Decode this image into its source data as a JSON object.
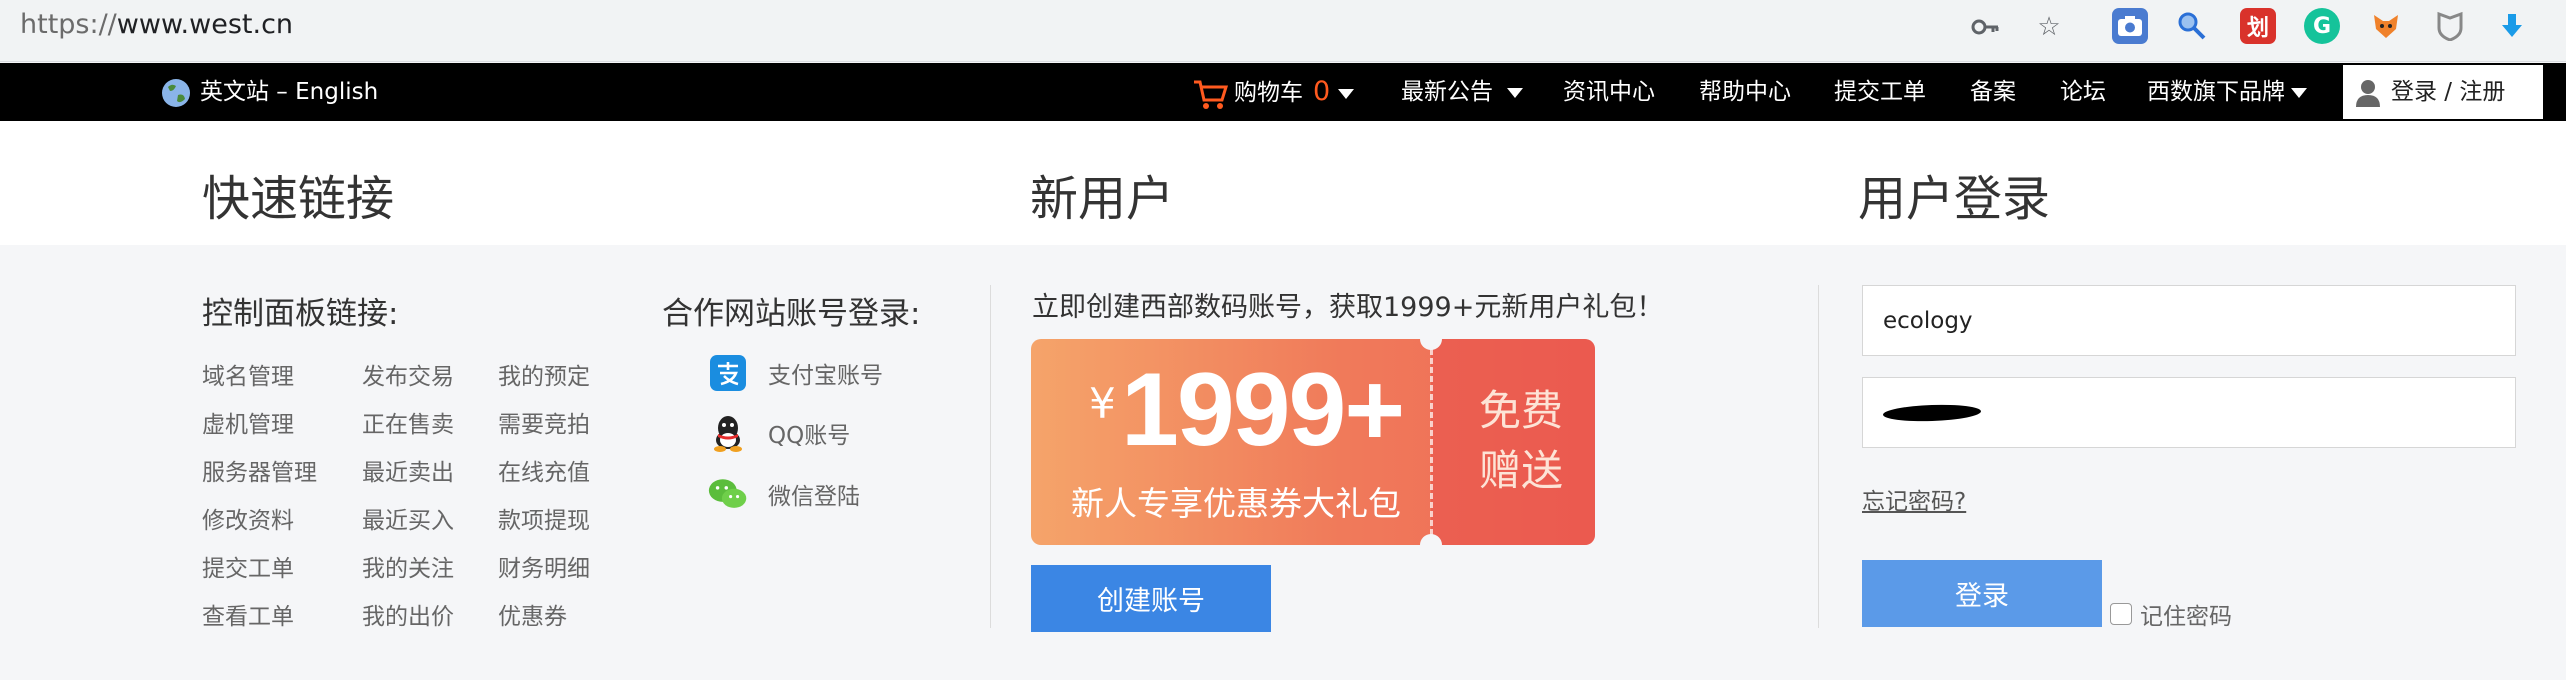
{
  "browser": {
    "url_scheme": "https://",
    "url_host": "www.west.cn",
    "icons": [
      "key-icon",
      "star-icon"
    ],
    "extensions": [
      "camera-extension-icon",
      "search-extension-icon",
      "red-extension-icon",
      "grammarly-icon",
      "fox-extension-icon",
      "shield-extension-icon",
      "download-arrow-icon"
    ]
  },
  "topnav": {
    "site_switch": "英文站 – English",
    "cart_label": "购物车",
    "cart_count": "0",
    "notice": "最新公告",
    "news": "资讯中心",
    "help": "帮助中心",
    "ticket": "提交工单",
    "beian": "备案",
    "forum": "论坛",
    "brands": "西数旗下品牌",
    "login": "登录 / 注册"
  },
  "headings": {
    "quick_links": "快速链接",
    "new_user": "新用户",
    "user_login": "用户登录"
  },
  "quick_links": {
    "panel_title": "控制面板链接:",
    "col1": [
      "域名管理",
      "虚机管理",
      "服务器管理",
      "修改资料",
      "提交工单",
      "查看工单"
    ],
    "col2": [
      "发布交易",
      "正在售卖",
      "最近卖出",
      "最近买入",
      "我的关注",
      "我的出价"
    ],
    "col3": [
      "我的预定",
      "需要竞拍",
      "在线充值",
      "款项提现",
      "财务明细",
      "优惠券"
    ],
    "partner_title": "合作网站账号登录:",
    "partners": [
      "支付宝账号",
      "QQ账号",
      "微信登陆"
    ]
  },
  "new_user": {
    "promo_text": "立即创建西部数码账号，获取1999+元新用户礼包！",
    "coupon_symbol": "¥",
    "coupon_amount": "1999+",
    "coupon_sub": "新人专享优惠券大礼包",
    "coupon_gift_line1": "免费",
    "coupon_gift_line2": "赠送",
    "create_button": "创建账号"
  },
  "login": {
    "username_value": "ecology",
    "forgot": "忘记密码?",
    "login_button": "登录",
    "remember": "记住密码"
  },
  "colors": {
    "nav_bg": "#000000",
    "accent_blue": "#3b86e4",
    "cart_count": "#ff5a1f",
    "coupon_start": "#f5a46a",
    "coupon_end": "#ee6a57"
  }
}
